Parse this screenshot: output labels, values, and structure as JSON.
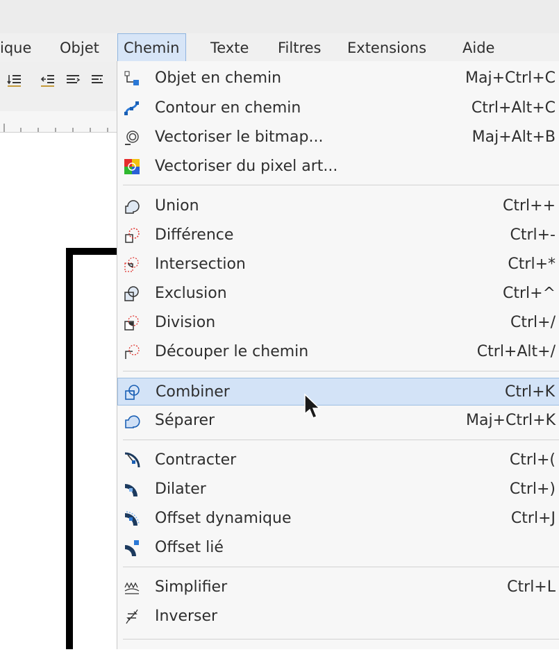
{
  "menubar": {
    "items": [
      {
        "label": "ique"
      },
      {
        "label": "Objet"
      },
      {
        "label": "Chemin"
      },
      {
        "label": "Texte"
      },
      {
        "label": "Filtres"
      },
      {
        "label": "Extensions"
      },
      {
        "label": "Aide"
      }
    ]
  },
  "menu": {
    "items": [
      {
        "label": "Objet en chemin",
        "shortcut": "Maj+Ctrl+C",
        "icon": "object-to-path-icon"
      },
      {
        "label": "Contour en chemin",
        "shortcut": "Ctrl+Alt+C",
        "icon": "stroke-to-path-icon"
      },
      {
        "label": "Vectoriser le bitmap...",
        "shortcut": "Maj+Alt+B",
        "icon": "trace-bitmap-icon"
      },
      {
        "label": "Vectoriser du pixel art...",
        "shortcut": "",
        "icon": "trace-pixel-art-icon"
      },
      {
        "label": "Union",
        "shortcut": "Ctrl++",
        "icon": "union-icon"
      },
      {
        "label": "Différence",
        "shortcut": "Ctrl+-",
        "icon": "difference-icon"
      },
      {
        "label": "Intersection",
        "shortcut": "Ctrl+*",
        "icon": "intersection-icon"
      },
      {
        "label": "Exclusion",
        "shortcut": "Ctrl+^",
        "icon": "exclusion-icon"
      },
      {
        "label": "Division",
        "shortcut": "Ctrl+/",
        "icon": "division-icon"
      },
      {
        "label": "Découper le chemin",
        "shortcut": "Ctrl+Alt+/",
        "icon": "cut-path-icon"
      },
      {
        "label": "Combiner",
        "shortcut": "Ctrl+K",
        "icon": "combine-icon",
        "highlighted": true
      },
      {
        "label": "Séparer",
        "shortcut": "Maj+Ctrl+K",
        "icon": "break-apart-icon"
      },
      {
        "label": "Contracter",
        "shortcut": "Ctrl+(",
        "icon": "inset-icon"
      },
      {
        "label": "Dilater",
        "shortcut": "Ctrl+)",
        "icon": "outset-icon"
      },
      {
        "label": "Offset dynamique",
        "shortcut": "Ctrl+J",
        "icon": "dynamic-offset-icon"
      },
      {
        "label": "Offset lié",
        "shortcut": "",
        "icon": "linked-offset-icon"
      },
      {
        "label": "Simplifier",
        "shortcut": "Ctrl+L",
        "icon": "simplify-icon"
      },
      {
        "label": "Inverser",
        "shortcut": "",
        "icon": "reverse-icon"
      }
    ]
  },
  "colors": {
    "accent": "#d3e3f7",
    "accent_border": "#9cbde2",
    "menu_bg": "#f7f7f7"
  }
}
